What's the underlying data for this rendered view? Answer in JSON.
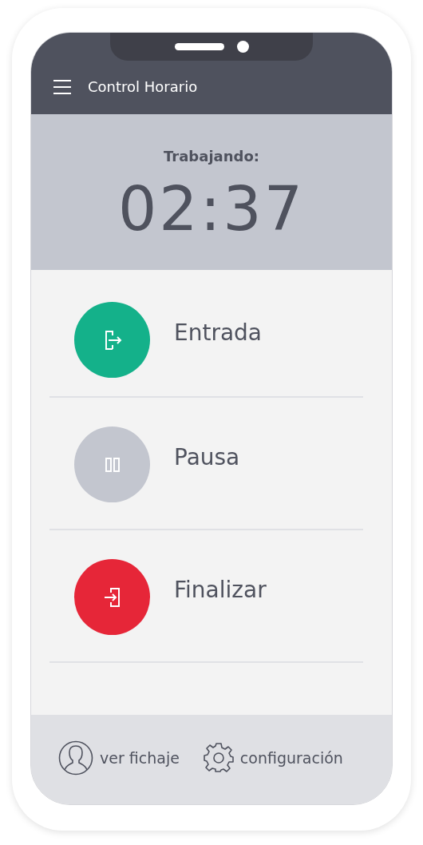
{
  "app_bar": {
    "title": "Control Horario"
  },
  "status": {
    "label": "Trabajando:",
    "time": "02:37"
  },
  "actions": [
    {
      "kind": "entrada",
      "label": "Entrada",
      "color": "#14b18a"
    },
    {
      "kind": "pausa",
      "label": "Pausa",
      "color": "#c3c6cf"
    },
    {
      "kind": "finalizar",
      "label": "Finalizar",
      "color": "#e62638"
    }
  ],
  "bottom_bar": [
    {
      "kind": "user",
      "label": "ver fichaje"
    },
    {
      "kind": "settings",
      "label": "configuración"
    }
  ]
}
